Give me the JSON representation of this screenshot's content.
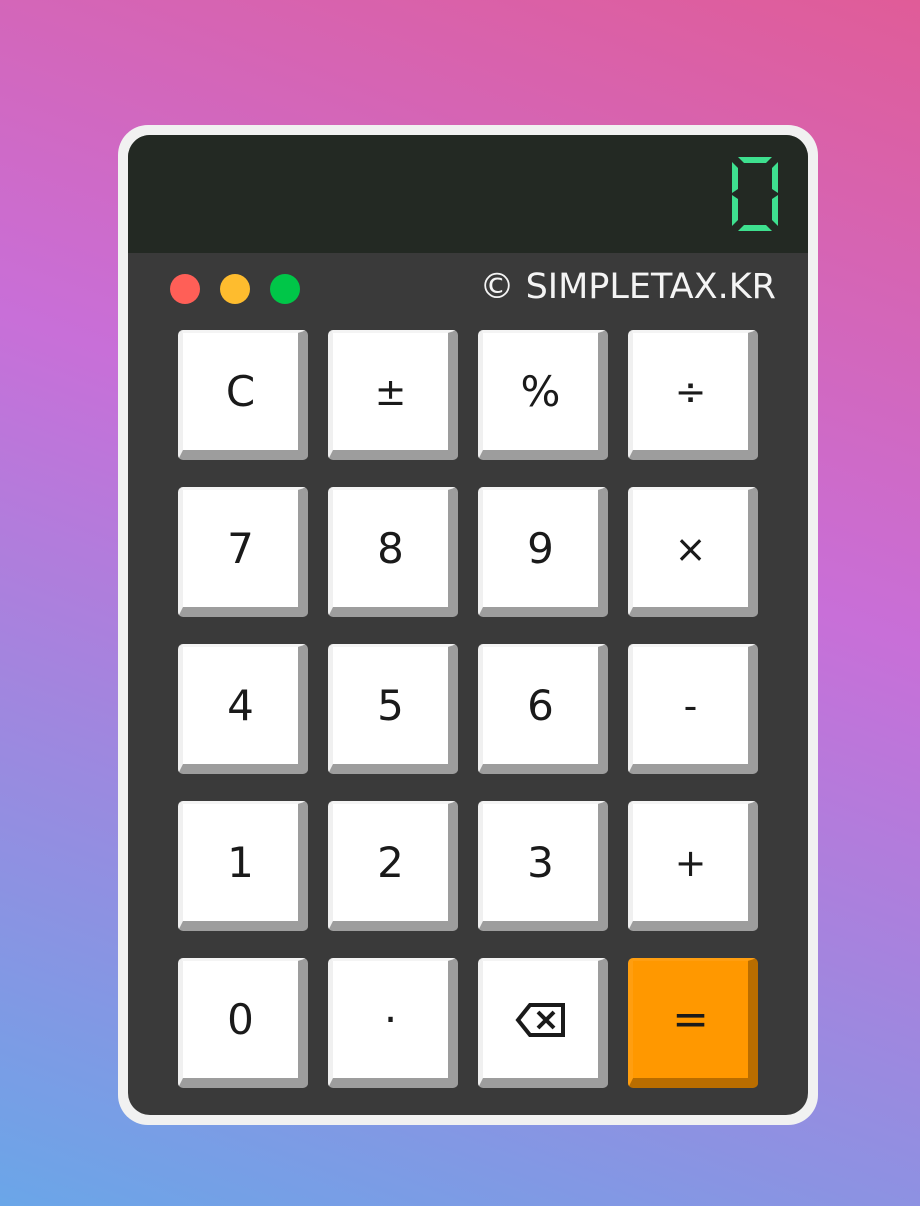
{
  "display": {
    "value": "0",
    "digit_color": "#3ee08f"
  },
  "window_controls": {
    "close_color": "#ff5f57",
    "minimize_color": "#febc2e",
    "maximize_color": "#00c648"
  },
  "brand": {
    "text": "© SIMPLETAX.KR"
  },
  "keys": [
    [
      "C",
      "±",
      "%",
      "÷"
    ],
    [
      "7",
      "8",
      "9",
      "×"
    ],
    [
      "4",
      "5",
      "6",
      "-"
    ],
    [
      "1",
      "2",
      "3",
      "+"
    ],
    [
      "0",
      "·",
      "backspace-icon",
      "="
    ]
  ],
  "colors": {
    "equals_key": "#ff9800",
    "key_face": "#ffffff",
    "body": "#3a3a3a",
    "display_bg": "#232923"
  }
}
